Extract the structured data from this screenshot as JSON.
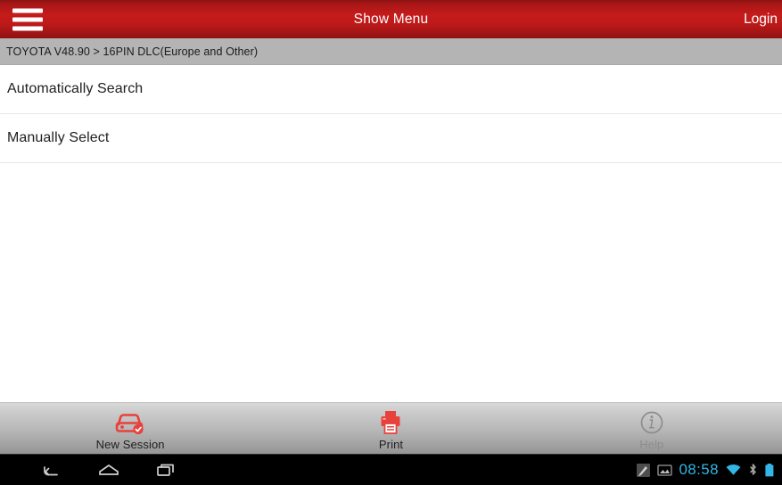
{
  "header": {
    "menu_icon": "hamburger-menu-icon",
    "title": "Show Menu",
    "login_label": "Login",
    "bg_color": "#c51b1b"
  },
  "pathbar": {
    "text": "TOYOTA V48.90 > 16PIN DLC(Europe and Other)",
    "bg_color": "#b4b4b4"
  },
  "menu": {
    "items": [
      {
        "label": "Automatically Search"
      },
      {
        "label": "Manually Select"
      }
    ]
  },
  "toolbar": {
    "buttons": [
      {
        "label": "New Session",
        "icon": "car-check-icon",
        "color": "#e8413c",
        "enabled": true
      },
      {
        "label": "Print",
        "icon": "printer-icon",
        "color": "#e8413c",
        "enabled": true
      },
      {
        "label": "Help",
        "icon": "info-circle-icon",
        "color": "#8d8d8d",
        "enabled": false
      }
    ]
  },
  "navbar": {
    "back_icon": "back-arrow-icon",
    "home_icon": "home-icon",
    "recents_icon": "recent-apps-icon",
    "status": {
      "screenshot_icon": "screenshot-icon",
      "gallery_icon": "image-icon",
      "clock": "08:58",
      "wifi_icon": "wifi-icon",
      "bluetooth_icon": "bluetooth-icon",
      "battery_icon": "battery-icon",
      "accent_color": "#33b5e5"
    }
  }
}
